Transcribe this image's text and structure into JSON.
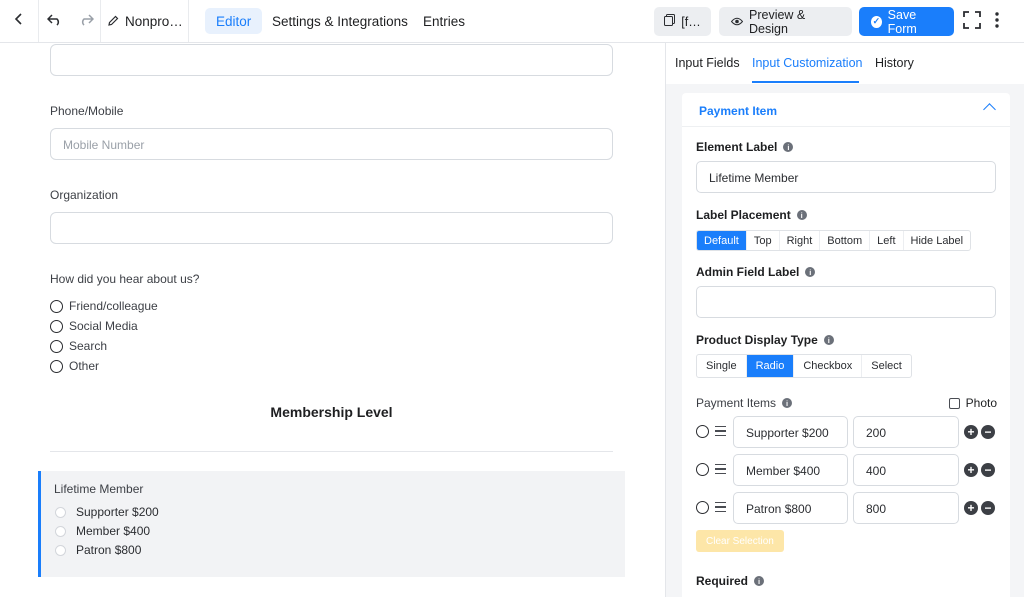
{
  "topbar": {
    "doc_title": "Nonpro…",
    "tabs": [
      "Editor",
      "Settings & Integrations",
      "Entries"
    ],
    "shortcode_label": "[f…",
    "preview_label": "Preview & Design",
    "save_label": "Save Form"
  },
  "editor": {
    "phone_label": "Phone/Mobile",
    "phone_placeholder": "Mobile Number",
    "org_label": "Organization",
    "hear_label": "How did you hear about us?",
    "hear_options": [
      "Friend/colleague",
      "Social Media",
      "Search",
      "Other"
    ],
    "section_title": "Membership Level",
    "payment_label": "Lifetime Member",
    "payment_options": [
      "Supporter $200",
      "Member $400",
      "Patron $800"
    ]
  },
  "panel": {
    "tabs": [
      "Input Fields",
      "Input Customization",
      "History"
    ],
    "card_title": "Payment Item",
    "element_label_title": "Element Label",
    "element_label_value": "Lifetime Member",
    "label_placement_title": "Label Placement",
    "label_placement_options": [
      "Default",
      "Top",
      "Right",
      "Bottom",
      "Left",
      "Hide Label"
    ],
    "admin_label_title": "Admin Field Label",
    "display_type_title": "Product Display Type",
    "display_type_options": [
      "Single",
      "Radio",
      "Checkbox",
      "Select"
    ],
    "payment_items_title": "Payment Items",
    "photo_label": "Photo",
    "items": [
      {
        "label": "Supporter $200",
        "value": "200"
      },
      {
        "label": "Member $400",
        "value": "400"
      },
      {
        "label": "Patron $800",
        "value": "800"
      }
    ],
    "clear_label": "Clear Selection",
    "required_title": "Required"
  },
  "colors": {
    "accent": "#1a7efb",
    "panel_bg": "#f4f5f7",
    "clear_button": "#fde6a8"
  }
}
